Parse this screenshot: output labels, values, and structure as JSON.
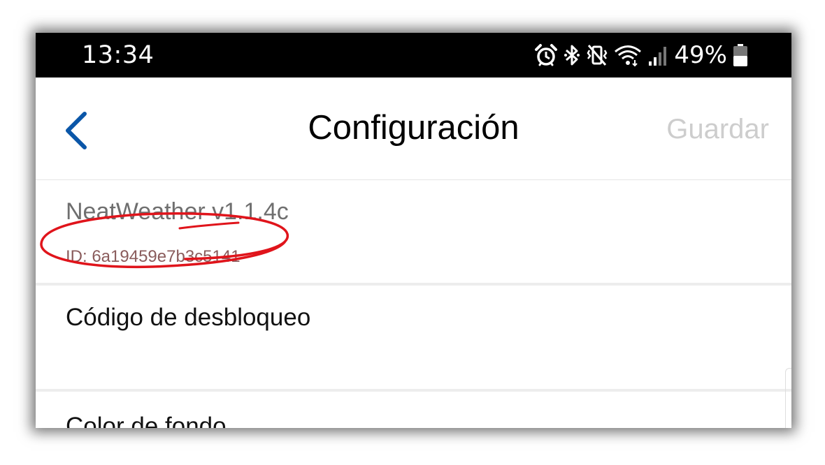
{
  "status_bar": {
    "time": "13:34",
    "battery_percent": "49%",
    "icons": [
      "alarm-icon",
      "bluetooth-icon",
      "vibrate-icon",
      "wifi-icon",
      "signal-icon",
      "battery-icon"
    ]
  },
  "app_bar": {
    "title": "Configuración",
    "save_label": "Guardar",
    "back_icon": "chevron-left-icon"
  },
  "info": {
    "app_version": "NeatWeather v1.1.4c",
    "device_id": "ID: 6a19459e7b3c5141"
  },
  "settings": {
    "unlock_code_label": "Código de desbloqueo",
    "background_color_label": "Color de fondo"
  },
  "colors": {
    "accent": "#0a56a8",
    "annotation": "#e0141b",
    "disabled_text": "#cdcdcd"
  }
}
